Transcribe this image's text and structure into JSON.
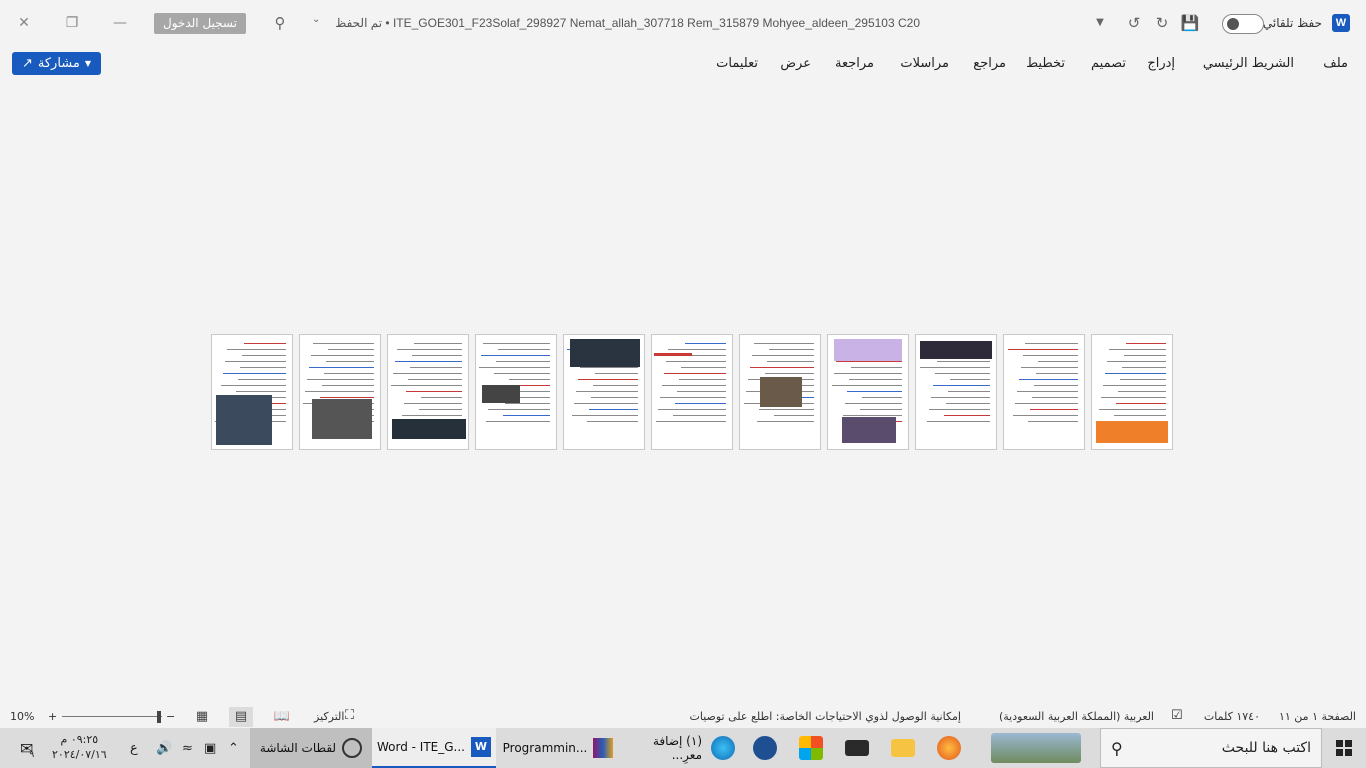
{
  "titlebar": {
    "autosave_label": "حفظ تلقائي",
    "document_title": "ITE_GOE301_F23Solaf_298927 Nemat_allah_307718 Rem_315879 Mohyee_aldeen_295103 C20 • تم الحفظ",
    "signin_label": "تسجيل الدخول",
    "word_logo": "W"
  },
  "ribbon": {
    "share_label": "مشاركة",
    "tabs": [
      {
        "label": "ملف"
      },
      {
        "label": "الشريط الرئيسي"
      },
      {
        "label": "إدراج"
      },
      {
        "label": "تصميم"
      },
      {
        "label": "تخطيط"
      },
      {
        "label": "مراجع"
      },
      {
        "label": "مراسلات"
      },
      {
        "label": "مراجعة"
      },
      {
        "label": "عرض"
      },
      {
        "label": "تعليمات"
      }
    ]
  },
  "statusbar": {
    "page_info": "الصفحة ١ من ١١",
    "word_count": "١٧٤٠ كلمات",
    "language": "العربية (المملكة العربية السعودية)",
    "accessibility": "إمكانية الوصول لذوي الاحتياجات الخاصة: اطلع على توصيات",
    "focus_label": "التركيز",
    "zoom_level": "10%",
    "zoom_minus": "−",
    "zoom_plus": "+"
  },
  "taskbar": {
    "search_placeholder": "اكتب هنا للبحث",
    "items": [
      {
        "label": "Programmin..."
      },
      {
        "label": "Word - ITE_G..."
      },
      {
        "label": "لقطات الشاشة"
      },
      {
        "label": "(١) إضافة معرِ..."
      }
    ],
    "time": "٠٩:٢٥ م",
    "date": "٢٠٢٤/٠٧/١٦",
    "notification_count": "٩",
    "keyboard_lang": "ع"
  },
  "document": {
    "page_count": 11
  }
}
